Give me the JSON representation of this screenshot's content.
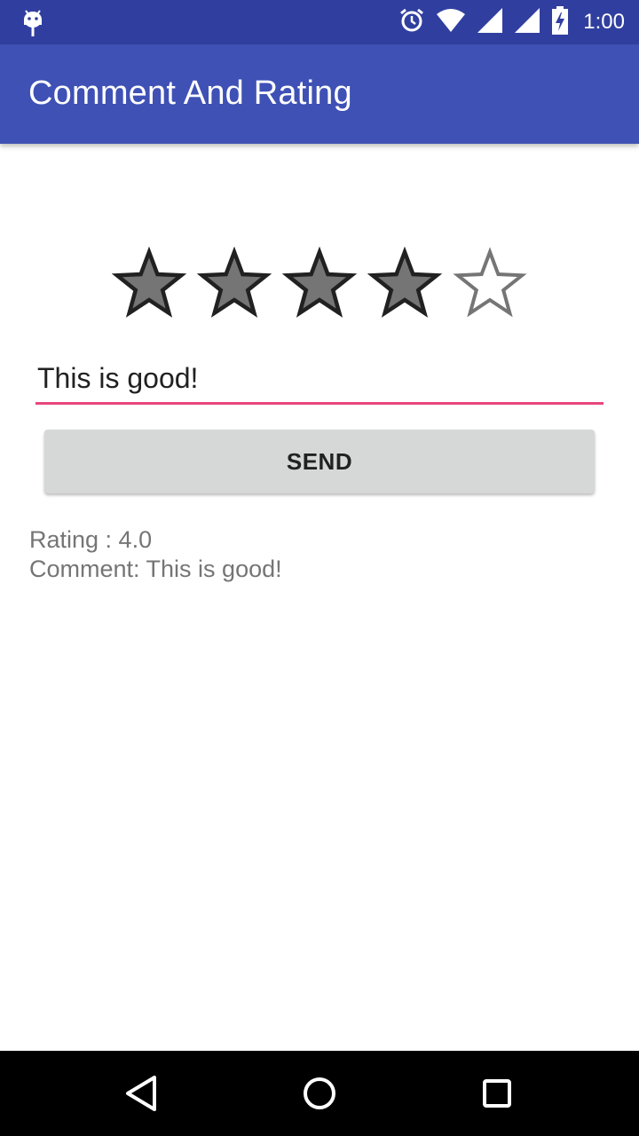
{
  "status_bar": {
    "time": "1:00",
    "icons": [
      "android-icon",
      "alarm-icon",
      "wifi-icon",
      "signal-icon",
      "signal-icon",
      "battery-charging-icon"
    ]
  },
  "app_bar": {
    "title": "Comment And Rating"
  },
  "rating": {
    "value": 4,
    "max": 5,
    "filled_color": "#757575",
    "outline_color": "#212121",
    "empty_color": "#757575"
  },
  "comment_field": {
    "value": "This is good!",
    "accent_color": "#e8467c"
  },
  "send_button": {
    "label": "SEND"
  },
  "result": {
    "rating_line": "Rating : 4.0",
    "comment_line": "Comment: This is good!"
  },
  "nav_bar": {
    "buttons": [
      "back-icon",
      "home-icon",
      "recents-icon"
    ]
  },
  "colors": {
    "status_bar": "#303f9f",
    "app_bar": "#3f51b5",
    "button_bg": "#d6d7d7"
  }
}
